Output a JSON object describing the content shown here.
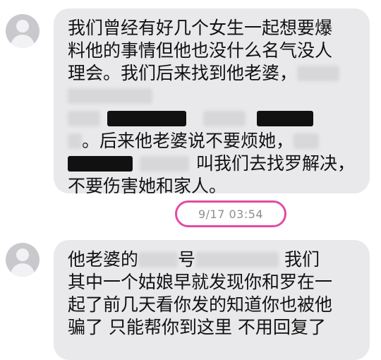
{
  "messages": [
    {
      "lines": [
        "我们曾经有好几个女生一起想要爆",
        "料他的事情但他也没什么名气没人",
        "理会。我们后来找到他老婆，",
        "",
        "",
        "叫我们去找罗解决，",
        "不要伤害她和家人。"
      ],
      "line5_prefix": "。后来他老婆说不要烦她，"
    },
    {
      "lines": [
        "他老婆的",
        "号",
        "我们",
        "其中一个姑娘早就发现你和罗在一",
        "起了前几天看你发的知道你也被他",
        "骗了 只能帮你到这里 不用回复了"
      ]
    }
  ],
  "timestamp": "9/17 03:54",
  "colors": {
    "bubble": "#e9e9eb",
    "highlight_circle": "#e34aa3",
    "timestamp_text": "#8e8e93"
  }
}
